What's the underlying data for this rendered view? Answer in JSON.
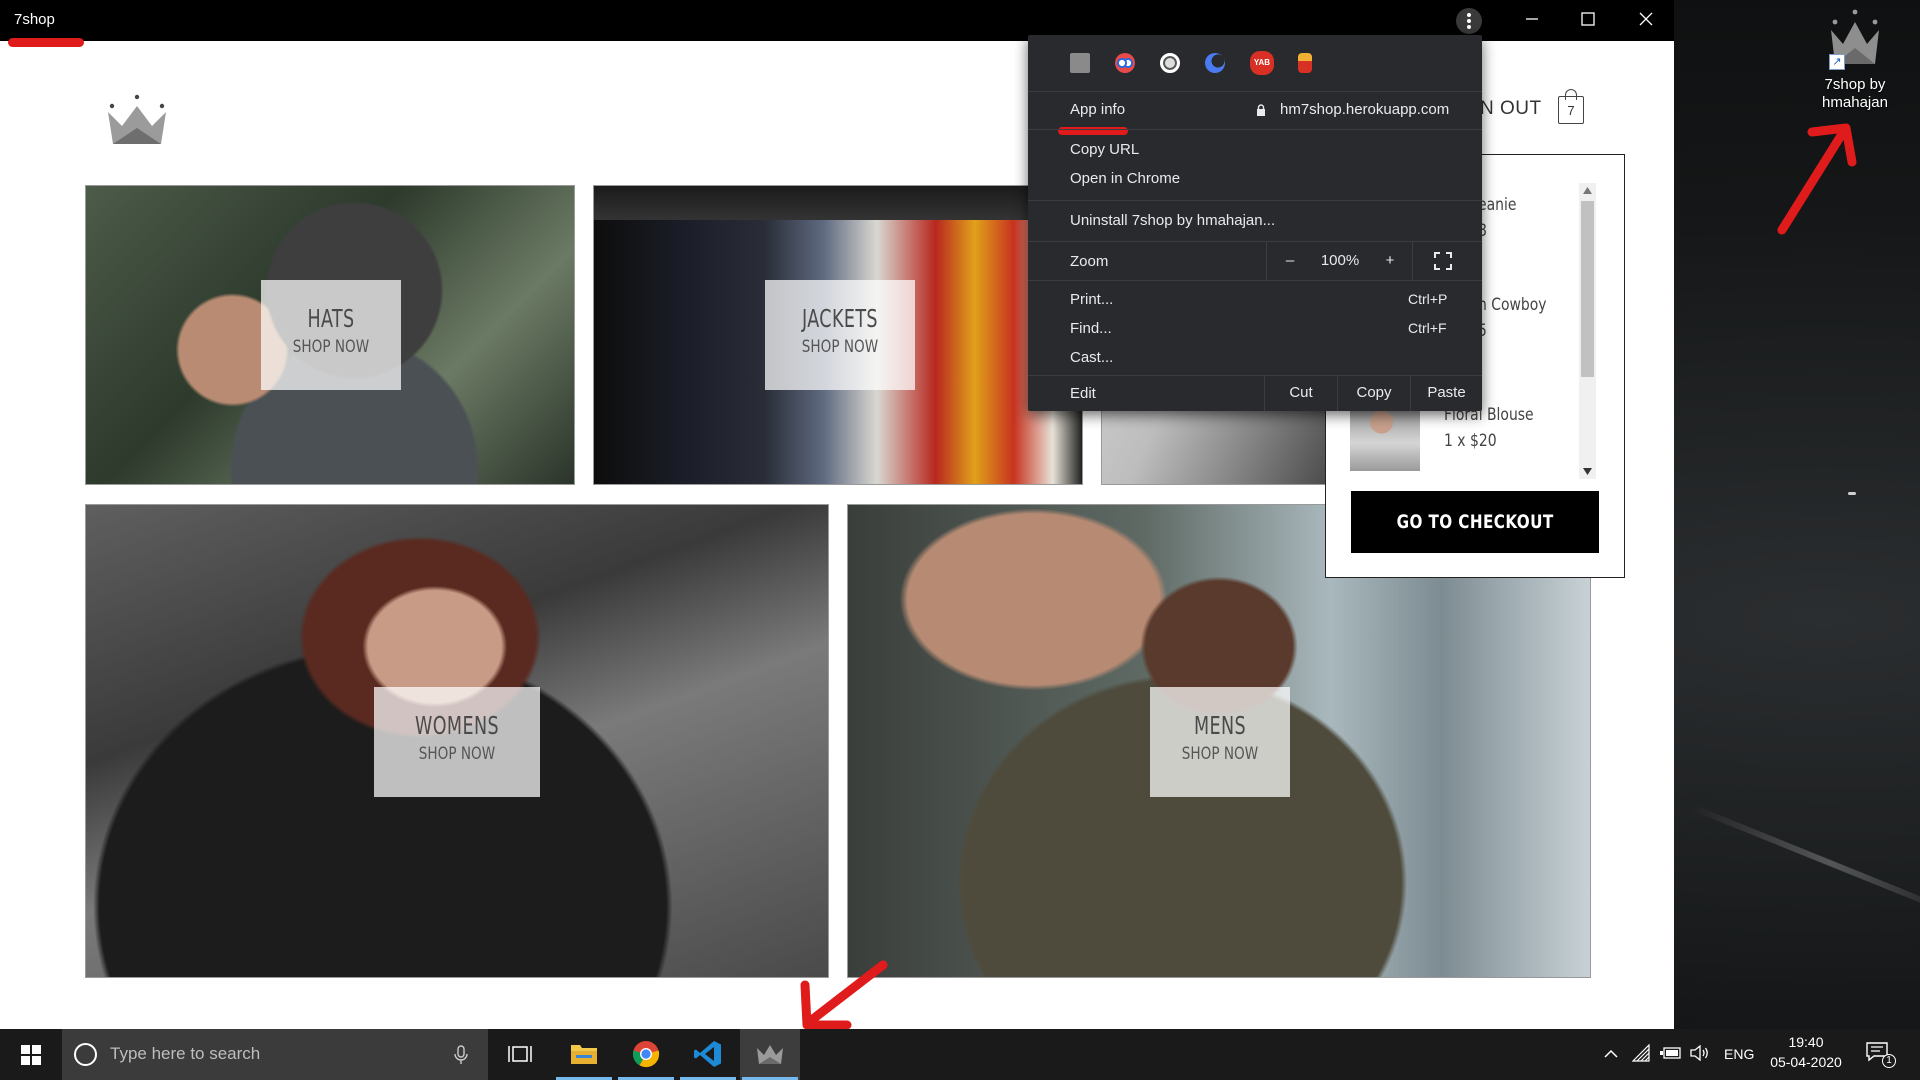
{
  "window": {
    "title": "7shop"
  },
  "page": {
    "nav_right_text": "N OUT",
    "cart_count": "7",
    "tiles": [
      {
        "category": "HATS",
        "cta": "SHOP NOW"
      },
      {
        "category": "JACKETS",
        "cta": "SHOP NOW"
      },
      {
        "category": "WOMENS",
        "cta": "SHOP NOW"
      },
      {
        "category": "MENS",
        "cta": "SHOP NOW"
      }
    ]
  },
  "cart": {
    "items": [
      {
        "name": "eanie",
        "qty": "8"
      },
      {
        "name": "n Cowboy",
        "qty": "5"
      },
      {
        "name": "Floral Blouse",
        "qty": "1 x $20"
      }
    ],
    "checkout_label": "GO TO CHECKOUT"
  },
  "menu": {
    "app_info": "App info",
    "url": "hm7shop.herokuapp.com",
    "copy_url": "Copy URL",
    "open_in_chrome": "Open in Chrome",
    "uninstall": "Uninstall 7shop by hmahajan...",
    "zoom_label": "Zoom",
    "zoom_minus": "–",
    "zoom_value": "100%",
    "zoom_plus": "+",
    "print": "Print...",
    "print_shortcut": "Ctrl+P",
    "find": "Find...",
    "find_shortcut": "Ctrl+F",
    "cast": "Cast...",
    "edit": "Edit",
    "cut": "Cut",
    "copy": "Copy",
    "paste": "Paste",
    "extension_icons": [
      "square-ext-icon",
      "owl-ext-icon",
      "block-ext-icon",
      "moon-ext-icon",
      "yab-ext-icon",
      "figure-ext-icon"
    ],
    "yab_text": "YAB"
  },
  "desktop": {
    "icon_label_line1": "7shop by",
    "icon_label_line2": "hmahajan"
  },
  "taskbar": {
    "search_placeholder": "Type here to search",
    "language": "ENG",
    "time": "19:40",
    "date": "05-04-2020",
    "notification_count": "1"
  },
  "colors": {
    "annotation_red": "#e01b1b",
    "menu_bg": "#292a2d",
    "taskbar_bg": "#1a1a1a",
    "active_underline": "#76b9ed"
  }
}
